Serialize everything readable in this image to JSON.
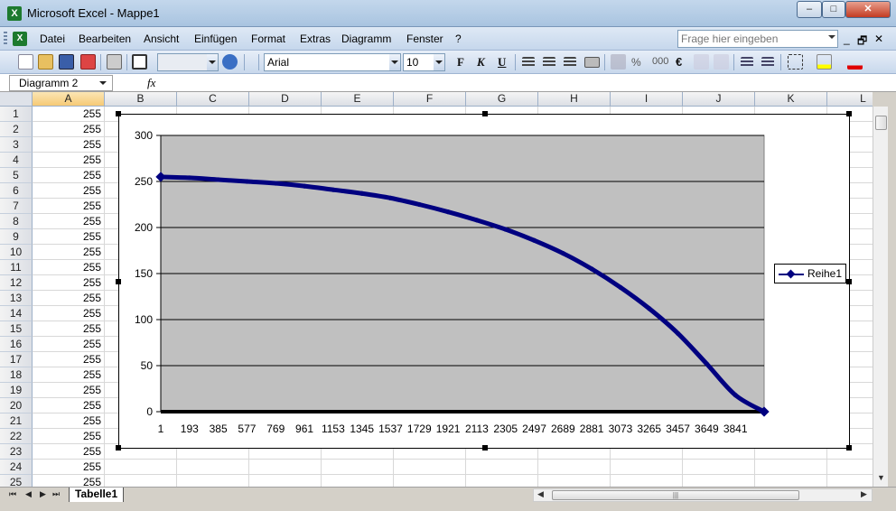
{
  "window": {
    "title": "Microsoft Excel - Mappe1",
    "app_icon": "X",
    "min": "–",
    "max": "□",
    "close": "✕"
  },
  "menu": {
    "items": [
      "Datei",
      "Bearbeiten",
      "Ansicht",
      "Einfügen",
      "Format",
      "Extras",
      "Diagramm",
      "Fenster",
      "?"
    ],
    "help_placeholder": "Frage hier eingeben",
    "mdi_min": "_",
    "mdi_restore": "🗗",
    "mdi_close": "✕"
  },
  "toolbar": {
    "font_name": "Arial",
    "font_size": "10",
    "bold": "F",
    "italic": "K",
    "underline": "U",
    "percent": "%",
    "thousands": "000",
    "euro": "€"
  },
  "formula_bar": {
    "name_box": "Diagramm 2",
    "fx": "fx"
  },
  "grid": {
    "columns": [
      "A",
      "B",
      "C",
      "D",
      "E",
      "F",
      "G",
      "H",
      "I",
      "J",
      "K",
      "L"
    ],
    "rows": [
      "1",
      "2",
      "3",
      "4",
      "5",
      "6",
      "7",
      "8",
      "9",
      "10",
      "11",
      "12",
      "13",
      "14",
      "15",
      "16",
      "17",
      "18",
      "19",
      "20",
      "21",
      "22",
      "23",
      "24",
      "25"
    ],
    "column_a_value": "255"
  },
  "chart_data": {
    "type": "line",
    "title": "",
    "xlabel": "",
    "ylabel": "",
    "ylim": [
      0,
      300
    ],
    "yticks": [
      0,
      50,
      100,
      150,
      200,
      250,
      300
    ],
    "xtick_labels": [
      "1",
      "193",
      "385",
      "577",
      "769",
      "961",
      "1153",
      "1345",
      "1537",
      "1729",
      "1921",
      "2113",
      "2305",
      "2497",
      "2689",
      "2881",
      "3073",
      "3265",
      "3457",
      "3649",
      "3841"
    ],
    "x_max": 4033,
    "grid": "horizontal",
    "plot_area_color": "#c0c0c0",
    "series_color": "#000080",
    "legend_position": "right",
    "series": [
      {
        "name": "Reihe1",
        "x": [
          1,
          193,
          385,
          577,
          769,
          961,
          1153,
          1345,
          1537,
          1729,
          1921,
          2113,
          2305,
          2497,
          2689,
          2881,
          3073,
          3265,
          3457,
          3649,
          3841,
          4033
        ],
        "values": [
          255,
          254,
          252,
          250,
          248,
          245,
          241,
          237,
          232,
          225,
          217,
          208,
          198,
          186,
          172,
          155,
          135,
          112,
          85,
          52,
          18,
          0
        ]
      }
    ]
  },
  "sheet_tabs": {
    "active": "Tabelle1"
  },
  "nav": {
    "first": "⏮",
    "prev": "◀",
    "next": "▶",
    "last": "⏭"
  },
  "scroll": {
    "up": "▲",
    "down": "▼",
    "left": "◀",
    "right": "▶",
    "grip": "|||"
  }
}
